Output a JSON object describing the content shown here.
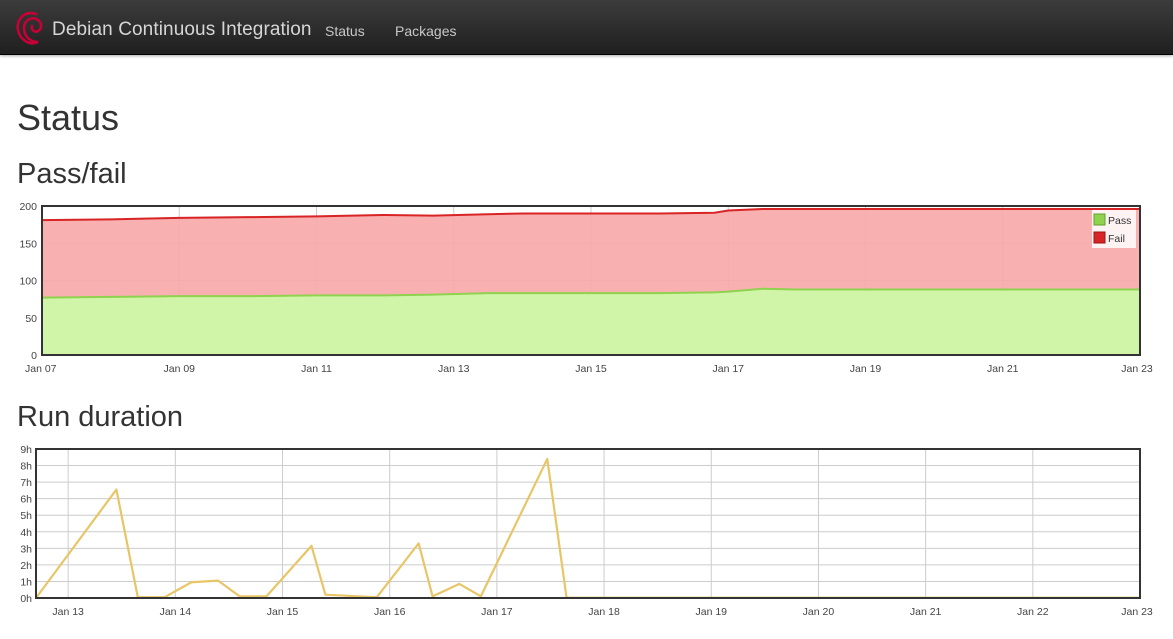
{
  "navbar": {
    "brand": "Debian Continuous Integration",
    "links": [
      {
        "label": "Status"
      },
      {
        "label": "Packages"
      }
    ]
  },
  "page": {
    "title": "Status"
  },
  "colors": {
    "pass_fill": "#d0f5a9",
    "pass_line": "#8fd24e",
    "fail_fill": "#f7a9aa",
    "fail_line": "#d82424",
    "duration_line": "#e8c566",
    "grid": "#cccccc",
    "axis": "#333333"
  },
  "charts": {
    "pass_fail": {
      "section_title": "Pass/fail",
      "chart_data": {
        "type": "area",
        "stacked": true,
        "x": [
          "Jan 07",
          "Jan 08",
          "Jan 09",
          "Jan 10",
          "Jan 11",
          "Jan 12",
          "Jan 12.7",
          "Jan 13.5",
          "Jan 14",
          "Jan 15",
          "Jan 16",
          "Jan 16.8",
          "Jan 17",
          "Jan 17.5",
          "Jan 18",
          "Jan 19",
          "Jan 20",
          "Jan 21",
          "Jan 22",
          "Jan 23"
        ],
        "series": [
          {
            "name": "Pass",
            "values": [
              77,
              78,
              79,
              79,
              80,
              80,
              81,
              83,
              83,
              83,
              83,
              84,
              85,
              89,
              88,
              88,
              88,
              88,
              88,
              88
            ]
          },
          {
            "name": "Fail",
            "values": [
              104,
              104,
              105,
              106,
              106,
              108,
              106,
              106,
              107,
              107,
              107,
              107,
              109,
              107,
              108,
              108,
              108,
              108,
              108,
              108
            ]
          }
        ],
        "x_tick_labels": [
          "Jan 07",
          "Jan 09",
          "Jan 11",
          "Jan 13",
          "Jan 15",
          "Jan 17",
          "Jan 19",
          "Jan 21",
          "Jan 23"
        ],
        "ylim": [
          0,
          200
        ],
        "y_tick_labels": [
          "0",
          "50",
          "100",
          "150",
          "200"
        ],
        "legend": "top-right",
        "legend_labels": [
          "Pass",
          "Fail"
        ],
        "grid": true
      }
    },
    "run_duration": {
      "section_title": "Run duration",
      "chart_data": {
        "type": "line",
        "x": [
          "Jan 12.7",
          "Jan 13.45",
          "Jan 13.65",
          "Jan 13.9",
          "Jan 14.15",
          "Jan 14.4",
          "Jan 14.6",
          "Jan 14.85",
          "Jan 15.27",
          "Jan 15.4",
          "Jan 15.88",
          "Jan 16.27",
          "Jan 16.4",
          "Jan 16.65",
          "Jan 16.85",
          "Jan 17.47",
          "Jan 17.65",
          "Jan 23"
        ],
        "series": [
          {
            "values": [
              0,
              6.55,
              0.05,
              0.05,
              0.95,
              1.05,
              0.1,
              0.1,
              3.15,
              0.2,
              0.05,
              3.3,
              0.1,
              0.85,
              0.1,
              8.4,
              0.02,
              0.02
            ]
          }
        ],
        "x_tick_labels": [
          "Jan 13",
          "Jan 14",
          "Jan 15",
          "Jan 16",
          "Jan 17",
          "Jan 18",
          "Jan 19",
          "Jan 20",
          "Jan 21",
          "Jan 22",
          "Jan 23"
        ],
        "ylim": [
          0,
          9
        ],
        "y_tick_labels": [
          "0h",
          "1h",
          "2h",
          "3h",
          "4h",
          "5h",
          "6h",
          "7h",
          "8h",
          "9h"
        ],
        "grid": true
      }
    }
  }
}
